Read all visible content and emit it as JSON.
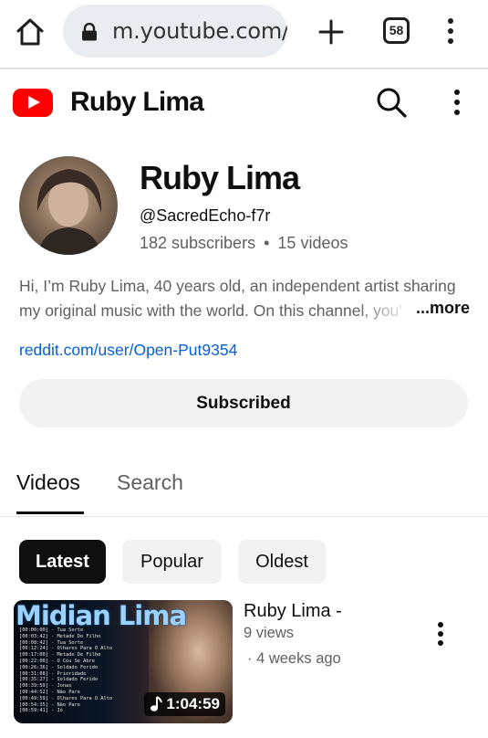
{
  "browser": {
    "url": "m.youtube.com/(",
    "tab_count": "58"
  },
  "header": {
    "title": "Ruby Lima"
  },
  "channel": {
    "name": "Ruby Lima",
    "handle": "@SacredEcho-f7r",
    "subscribers": "182 subscribers",
    "separator": "•",
    "videos": "15 videos",
    "description_line1": "Hi, I’m Ruby Lima, 40 years old, an independent artist sharing",
    "description_line2": "my original music with the world. On this channel, you'",
    "more_label": "...more",
    "link": "reddit.com/user/Open-Put9354",
    "subscribe_label": "Subscribed"
  },
  "tabs": [
    {
      "label": "Videos",
      "selected": true
    },
    {
      "label": "Search",
      "selected": false
    }
  ],
  "chips": [
    {
      "label": "Latest",
      "selected": true
    },
    {
      "label": "Popular",
      "selected": false
    },
    {
      "label": "Oldest",
      "selected": false
    }
  ],
  "videos": [
    {
      "title": "Ruby Lima -",
      "views": "9 views",
      "age": "· 4 weeks ago",
      "duration": "1:04:59",
      "thumbnail_title": "Midian Lima",
      "thumbnail_tracks": [
        "[00:00:00] - Tua Sorte",
        "[00:03:42] - Metade Do Filho",
        "[00:08:42] - Tua Sorte",
        "[00:12:24] - Olhares Para O Alto",
        "[00:17:00] - Metade De Filho",
        "[00:22:00] - O Céu Se Abre",
        "[00:26:36] - Soldado Ferido",
        "[00:31:08] - Prioridade",
        "[00:35:27] - Soldado Ferido",
        "[00:39:59] - Jonas",
        "[00:44:52] - Não Pare",
        "[00:49:59] - Olhares Para O Alto",
        "[00:54:35] - Não Pare",
        "[00:59:41] - Jó"
      ]
    }
  ],
  "colors": {
    "brand_red": "#ff0000",
    "link_blue": "#065fd4",
    "text_primary": "#0f0f0f",
    "text_secondary": "#606060",
    "chip_bg": "#f2f2f2"
  },
  "icons": {
    "home": "home-icon",
    "lock": "lock-icon",
    "new_tab": "plus-icon",
    "overflow": "more-vert-icon",
    "search": "search-icon",
    "music_note": "music-note-icon",
    "logo": "youtube-logo-icon"
  }
}
